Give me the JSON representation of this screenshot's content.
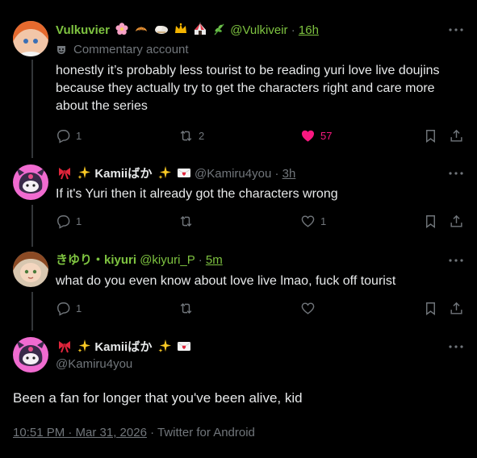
{
  "posts": [
    {
      "name": "Vulkuvier",
      "handle": "@Vulkiveir",
      "sep": "·",
      "time": "16h",
      "badge": "Commentary account",
      "text": "honestly it’s probably less tourist to be reading yuri love live doujins because they actually try to get the characters right and care more about the series",
      "replies": "1",
      "reposts": "2",
      "likes": "57",
      "liked": true,
      "name_color": "#7ec340",
      "icons": [
        "cherry-blossom-icon",
        "croissant-icon",
        "cloud-bread-icon",
        "crown-icon",
        "circus-tent-icon",
        "herb-icon"
      ]
    },
    {
      "name": "Kamiiばか",
      "handle": "@Kamiru4you",
      "sep": "·",
      "time": "3h",
      "text": "If it's Yuri then it already got the characters wrong",
      "replies": "1",
      "reposts": "",
      "likes": "1",
      "icons": [
        "ribbon-icon",
        "sparkles-icon",
        "sparkles-icon",
        "love-letter-icon"
      ]
    },
    {
      "name": "きゆり・kiyuri",
      "handle": "@kiyuri_P",
      "sep": "·",
      "time": "5m",
      "text": "what do you even know about love live lmao, fuck off tourist",
      "replies": "1",
      "reposts": "",
      "likes": "",
      "name_color": "#7ec340"
    }
  ],
  "main": {
    "name": "Kamiiばか",
    "handle": "@Kamiru4you",
    "text": "Been a fan for longer that you've been alive, kid",
    "timestamp": "10:51 PM · Mar 31, 2026",
    "dot": "·",
    "client": "Twitter for Android"
  },
  "colors": {
    "accent_like": "#f91880",
    "muted": "#71767b",
    "line": "#333639"
  }
}
